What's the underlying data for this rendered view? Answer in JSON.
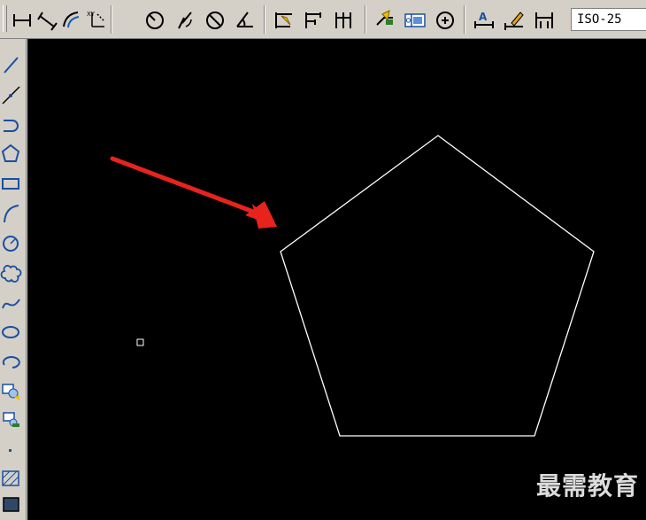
{
  "toolbar": {
    "dimension_style": "ISO-25",
    "icons": [
      "linear-dimension-icon",
      "aligned-dimension-icon",
      "arc-length-icon",
      "ordinate-dimension-icon",
      "radius-dimension-icon",
      "jogged-dimension-icon",
      "diameter-dimension-icon",
      "angular-dimension-icon",
      "quick-dimension-icon",
      "baseline-dimension-icon",
      "continue-dimension-icon",
      "quick-leader-icon",
      "tolerance-icon",
      "center-mark-icon",
      "dimension-edit-icon",
      "dimension-text-edit-icon",
      "dimension-update-icon"
    ]
  },
  "draw_toolbar": {
    "icons": [
      "line-icon",
      "construction-line-icon",
      "polyline-icon",
      "polygon-icon",
      "rectangle-icon",
      "arc-icon",
      "circle-icon",
      "revision-cloud-icon",
      "spline-icon",
      "ellipse-icon",
      "ellipse-arc-icon",
      "insert-block-icon",
      "make-block-icon",
      "point-icon",
      "hatch-icon",
      "gradient-icon"
    ]
  },
  "drawing": {
    "shape": "pentagon",
    "background": "#000000",
    "stroke_color": "#ffffff",
    "annotation_color": "#e8231d"
  },
  "watermark": "最需教育"
}
